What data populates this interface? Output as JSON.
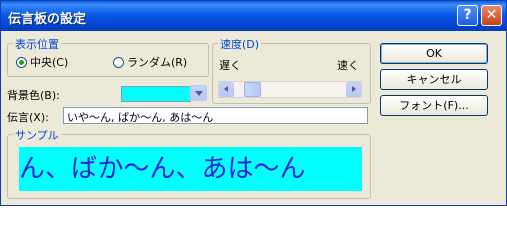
{
  "window": {
    "title": "伝言板の設定",
    "help_button": "?",
    "close_button": "✕"
  },
  "position_group": {
    "title": "表示位置",
    "options": [
      {
        "label": "中央(C)",
        "selected": true
      },
      {
        "label": "ランダム(R)",
        "selected": false
      }
    ]
  },
  "speed_group": {
    "title": "速度(D)",
    "slow_label": "遅く",
    "fast_label": "速く",
    "value_fraction": 0.08
  },
  "background": {
    "label": "背景色(B):",
    "color": "#00ffff"
  },
  "message": {
    "label": "伝言(X):",
    "value": "いや〜ん, ばか〜ん, あは〜ん"
  },
  "sample_group": {
    "title": "サンプル",
    "text": "ん、ばか〜ん、あは〜ん",
    "text_color": "#2424d6"
  },
  "buttons": {
    "ok": "OK",
    "cancel": "キャンセル",
    "font": "フォント(F)..."
  }
}
